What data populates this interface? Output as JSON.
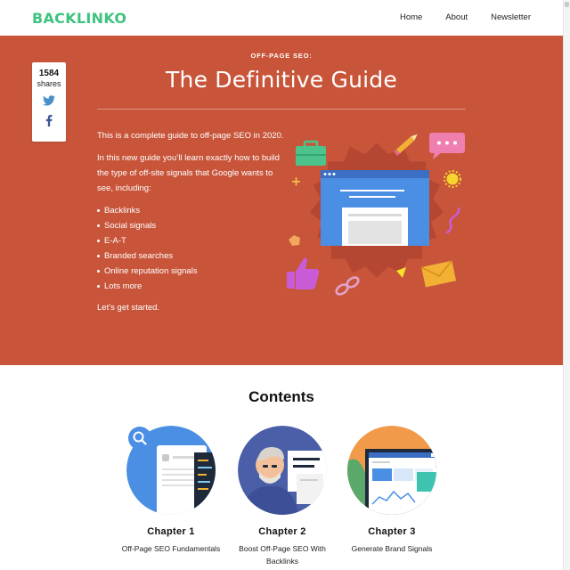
{
  "header": {
    "logo": "BACKLINKO",
    "nav": [
      "Home",
      "About",
      "Newsletter"
    ]
  },
  "share": {
    "count": "1584",
    "label": "shares",
    "twitter_icon": "twitter-icon",
    "facebook_icon": "facebook-icon"
  },
  "hero": {
    "kicker": "OFF-PAGE SEO:",
    "title": "The Definitive Guide",
    "intro": "This is a complete guide to off-page SEO in 2020.",
    "lead": "In this new guide you’ll learn exactly how to build the type of off-site signals that Google wants to see, including:",
    "list": [
      "Backlinks",
      "Social signals",
      "E-A-T",
      "Branded searches",
      "Online reputation signals",
      "Lots more"
    ],
    "cta": "Let’s get started.",
    "background": "#c8553a"
  },
  "contents": {
    "title": "Contents",
    "chapters": [
      {
        "number": "Chapter 1",
        "name": "Off-Page SEO Fundamentals"
      },
      {
        "number": "Chapter 2",
        "name": "Boost Off-Page SEO With Backlinks"
      },
      {
        "number": "Chapter 3",
        "name": "Generate Brand Signals"
      }
    ]
  },
  "colors": {
    "brand": "#3ec37f",
    "hero": "#c8553a"
  }
}
